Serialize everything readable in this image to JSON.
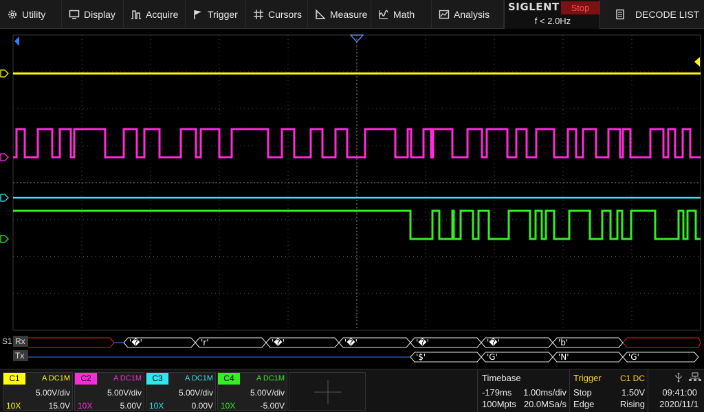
{
  "menu": {
    "utility": "Utility",
    "display": "Display",
    "acquire": "Acquire",
    "trigger": "Trigger",
    "cursors": "Cursors",
    "measure": "Measure",
    "math": "Math",
    "analysis": "Analysis",
    "decode_list": "DECODE LIST"
  },
  "brand": {
    "name": "SIGLENT",
    "state": "Stop",
    "frequency": "f < 2.0Hz"
  },
  "bus": {
    "label": "S1",
    "rx": "Rx",
    "tx": "Tx",
    "rx_frames": [
      "'�'",
      "'r'",
      "'�'",
      "'�'",
      "'�'",
      "'�'",
      "'b'"
    ],
    "tx_frames": [
      "'$'",
      "'G'",
      "'N'",
      "'G'"
    ]
  },
  "channels": [
    {
      "name": "C1",
      "coupling": "A DC1M",
      "vdiv": "5.00V/div",
      "probe": "10X",
      "offset": "15.0V",
      "color": "#ffff00"
    },
    {
      "name": "C2",
      "coupling": "A DC1M",
      "vdiv": "5.00V/div",
      "probe": "10X",
      "offset": "5.00V",
      "color": "#ff2bd8"
    },
    {
      "name": "C3",
      "coupling": "A DC1M",
      "vdiv": "5.00V/div",
      "probe": "10X",
      "offset": "0.00V",
      "color": "#2fe6f0"
    },
    {
      "name": "C4",
      "coupling": "A DC1M",
      "vdiv": "5.00V/div",
      "probe": "10X",
      "offset": "-5.00V",
      "color": "#33ee22"
    }
  ],
  "timebase": {
    "title": "Timebase",
    "delay": "-179ms",
    "scale": "1.00ms/div",
    "memory": "100Mpts",
    "rate": "20.0MSa/s"
  },
  "trigger": {
    "title": "Trigger",
    "source": "C1 DC",
    "mode": "Stop",
    "level": "1.50V",
    "type": "Edge",
    "slope": "Rising"
  },
  "clock": {
    "time": "09:41:00",
    "date": "2020/11/1"
  }
}
